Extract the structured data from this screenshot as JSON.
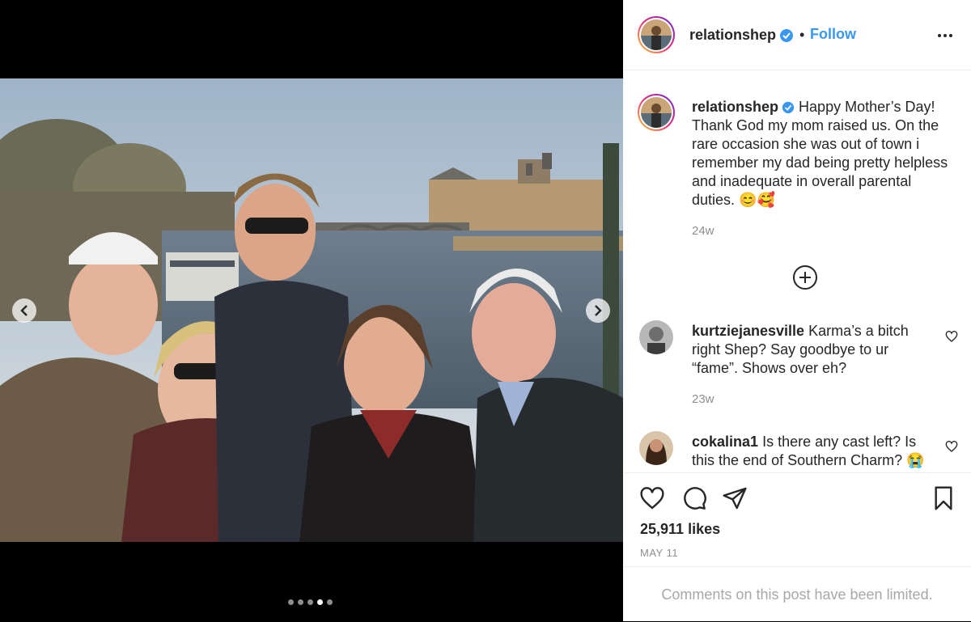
{
  "post": {
    "username": "relationshep",
    "follow_label": "Follow",
    "separator": "•",
    "photo_description": "Family of five posing on a bridge over the Seine in Paris with the Louvre behind them",
    "carousel": {
      "count": 5,
      "active_index": 3
    }
  },
  "caption": {
    "username": "relationshep",
    "text": "Happy Mother’s Day! Thank God my mom raised us. On the rare occasion she was out of town i remember my dad being pretty helpless and inadequate in overall parental duties. 😊🥰",
    "time": "24w"
  },
  "comments": [
    {
      "username": "kurtziejanesville",
      "text": "Karma’s a bitch right Shep? Say goodbye to ur “fame”. Shows over eh?",
      "time": "23w"
    },
    {
      "username": "cokalina1",
      "text": "Is there any cast left? Is this the end of Southern Charm? 😭",
      "time": ""
    }
  ],
  "stats": {
    "likes": "25,911 likes",
    "date": "MAY 11"
  },
  "footer": {
    "limited_text": "Comments on this post have been limited."
  },
  "colors": {
    "accent": "#3897f0",
    "verified": "#3897f0",
    "text": "#262626",
    "muted": "#8e8e8e"
  }
}
